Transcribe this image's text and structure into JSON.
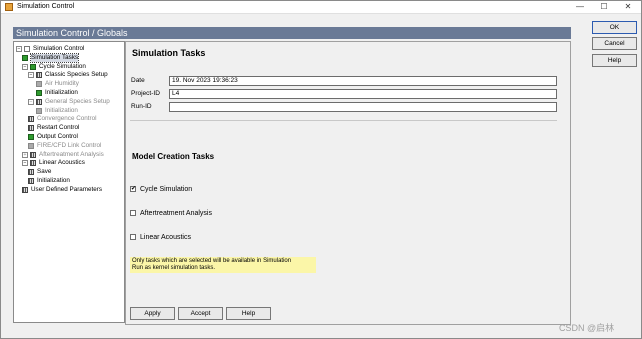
{
  "window": {
    "title": "Simulation Control",
    "controls": {
      "minimize": "—",
      "maximize": "☐",
      "close": "✕"
    }
  },
  "banner": "Simulation Control / Globals",
  "tree": [
    {
      "label": "Simulation Control",
      "expander": "−",
      "icon": "page",
      "disabled": false,
      "selected": false
    },
    {
      "label": "Simulation Tasks",
      "expander": "",
      "icon": "green",
      "disabled": false,
      "selected": true
    },
    {
      "label": "Cycle Simulation",
      "expander": "−",
      "icon": "green",
      "disabled": false,
      "selected": false
    },
    {
      "label": "Classic Species Setup",
      "expander": "−",
      "icon": "grid",
      "disabled": false,
      "selected": false
    },
    {
      "label": "Air Humidity",
      "expander": "",
      "icon": "grey",
      "disabled": true,
      "selected": false
    },
    {
      "label": "Initialization",
      "expander": "",
      "icon": "green",
      "disabled": false,
      "selected": false
    },
    {
      "label": "General Species Setup",
      "expander": "−",
      "icon": "grid",
      "disabled": true,
      "selected": false
    },
    {
      "label": "Initialization",
      "expander": "",
      "icon": "grey",
      "disabled": true,
      "selected": false
    },
    {
      "label": "Convergence Control",
      "expander": "",
      "icon": "grid",
      "disabled": true,
      "selected": false
    },
    {
      "label": "Restart Control",
      "expander": "",
      "icon": "grid",
      "disabled": false,
      "selected": false
    },
    {
      "label": "Output Control",
      "expander": "",
      "icon": "green",
      "disabled": false,
      "selected": false
    },
    {
      "label": "FIRE/CFD Link Control",
      "expander": "",
      "icon": "grey",
      "disabled": true,
      "selected": false
    },
    {
      "label": "Aftertreatment Analysis",
      "expander": "+",
      "icon": "grid",
      "disabled": true,
      "selected": false
    },
    {
      "label": "Linear Acoustics",
      "expander": "−",
      "icon": "grid",
      "disabled": false,
      "selected": false
    },
    {
      "label": "Save",
      "expander": "",
      "icon": "grid",
      "disabled": false,
      "selected": false
    },
    {
      "label": "Initialization",
      "expander": "",
      "icon": "grid",
      "disabled": false,
      "selected": false
    },
    {
      "label": "User Defined Parameters",
      "expander": "",
      "icon": "grid",
      "disabled": false,
      "selected": false
    }
  ],
  "panel": {
    "title": "Simulation Tasks",
    "fields": {
      "date": {
        "label": "Date",
        "value": "19. Nov 2023 19:36:23"
      },
      "project_id": {
        "label": "Project-ID",
        "value": "L4"
      },
      "run_id": {
        "label": "Run-ID",
        "value": ""
      }
    },
    "section_title": "Model Creation Tasks",
    "checks": [
      {
        "label": "Cycle Simulation",
        "checked": true
      },
      {
        "label": "Aftertreatment Analysis",
        "checked": false
      },
      {
        "label": "Linear Acoustics",
        "checked": false
      }
    ],
    "note_line1": "Only tasks which are selected will be available in Simulation",
    "note_line2": "Run as kernel simulation tasks.",
    "buttons": {
      "apply": "Apply",
      "accept": "Accept",
      "help": "Help"
    }
  },
  "side_buttons": {
    "ok": "OK",
    "cancel": "Cancel",
    "help": "Help"
  },
  "watermark": "CSDN @启林"
}
